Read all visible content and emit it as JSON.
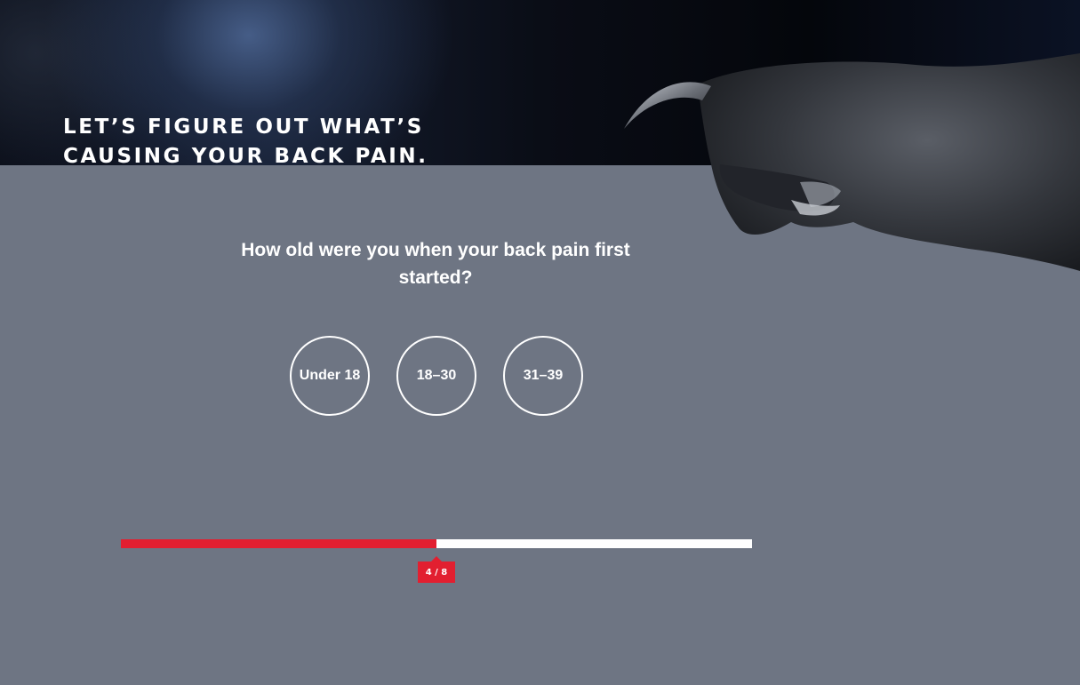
{
  "hero": {
    "title": "LET’S FIGURE OUT WHAT’S\nCAUSING YOUR BACK PAIN.",
    "image_icon": "monster-claw-icon"
  },
  "quiz": {
    "question": "How old were you when your back pain first started?",
    "options": [
      {
        "label": "Under 18"
      },
      {
        "label": "18–30"
      },
      {
        "label": "31–39"
      }
    ]
  },
  "progress": {
    "current": 4,
    "total": 8,
    "fraction": 0.5,
    "label": "4 / 8"
  },
  "colors": {
    "background": "#6e7583",
    "accent": "#e21f30",
    "track": "#ffffff",
    "text": "#ffffff"
  }
}
